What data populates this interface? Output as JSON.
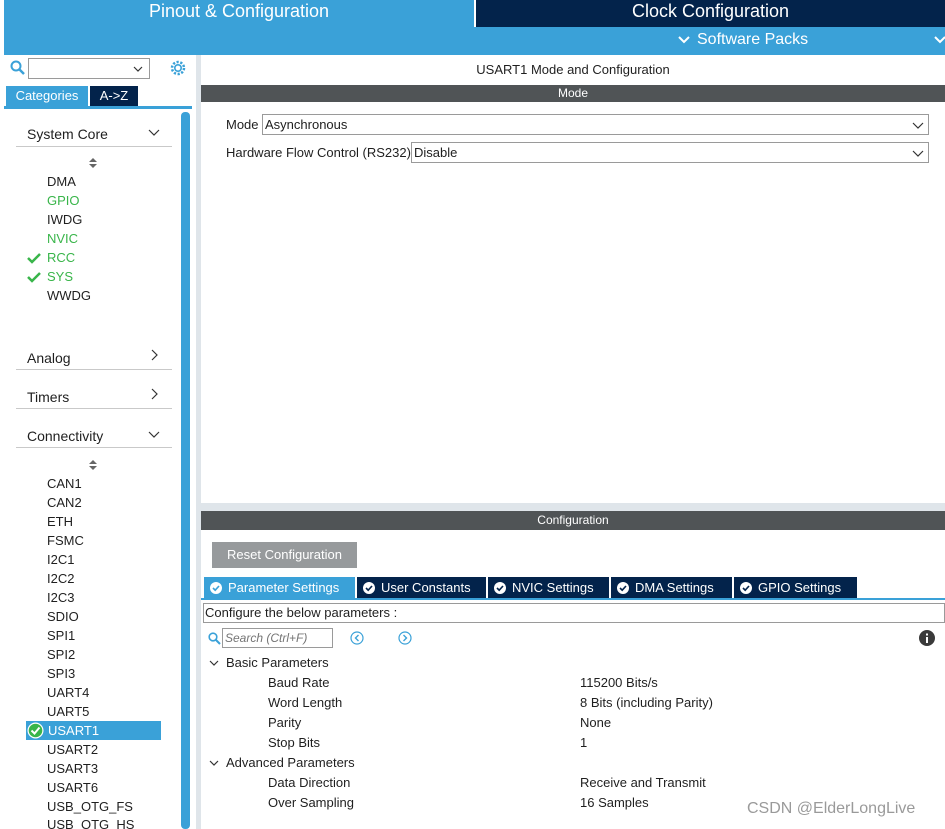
{
  "top_tabs": {
    "pinout": "Pinout & Configuration",
    "clock": "Clock Configuration",
    "software_packs": "Software Packs"
  },
  "left_panel": {
    "search": {
      "value": "",
      "placeholder": ""
    },
    "view_buttons": {
      "categories": "Categories",
      "az": "A->Z"
    },
    "system_core": {
      "title": "System Core",
      "items": [
        {
          "label": "DMA",
          "status": "none"
        },
        {
          "label": "GPIO",
          "status": "green"
        },
        {
          "label": "IWDG",
          "status": "none"
        },
        {
          "label": "NVIC",
          "status": "green"
        },
        {
          "label": "RCC",
          "status": "checked"
        },
        {
          "label": "SYS",
          "status": "checked"
        },
        {
          "label": "WWDG",
          "status": "none"
        }
      ]
    },
    "analog": {
      "title": "Analog"
    },
    "timers": {
      "title": "Timers"
    },
    "connectivity": {
      "title": "Connectivity",
      "items": [
        "CAN1",
        "CAN2",
        "ETH",
        "FSMC",
        "I2C1",
        "I2C2",
        "I2C3",
        "SDIO",
        "SPI1",
        "SPI2",
        "SPI3",
        "UART4",
        "UART5",
        "USART1",
        "USART2",
        "USART3",
        "USART6",
        "USB_OTG_FS",
        "USB_OTG_HS"
      ],
      "selected": "USART1"
    }
  },
  "mode_panel": {
    "title": "USART1 Mode and Configuration",
    "header": "Mode",
    "mode_label": "Mode",
    "mode_value": "Asynchronous",
    "flow_label": "Hardware Flow Control (RS232)",
    "flow_value": "Disable"
  },
  "config_panel": {
    "header": "Configuration",
    "reset_button": "Reset Configuration",
    "tabs": [
      {
        "label": "Parameter Settings",
        "active": true
      },
      {
        "label": "User Constants",
        "active": false
      },
      {
        "label": "NVIC Settings",
        "active": false
      },
      {
        "label": "DMA Settings",
        "active": false
      },
      {
        "label": "GPIO Settings",
        "active": false
      }
    ],
    "description": "Configure the below parameters :",
    "search_placeholder": "Search (Ctrl+F)",
    "groups": [
      {
        "title": "Basic Parameters",
        "params": [
          {
            "name": "Baud Rate",
            "value": "115200 Bits/s"
          },
          {
            "name": "Word Length",
            "value": "8 Bits (including Parity)"
          },
          {
            "name": "Parity",
            "value": "None"
          },
          {
            "name": "Stop Bits",
            "value": "1"
          }
        ]
      },
      {
        "title": "Advanced Parameters",
        "params": [
          {
            "name": "Data Direction",
            "value": "Receive and Transmit"
          },
          {
            "name": "Over Sampling",
            "value": "16 Samples"
          }
        ]
      }
    ]
  },
  "watermark": "CSDN @ElderLongLive",
  "colors": {
    "accent_blue": "#3aa1d8",
    "dark_navy": "#03234b",
    "header_gray": "#505456",
    "status_green": "#39b54a",
    "button_gray": "#979a9c"
  }
}
